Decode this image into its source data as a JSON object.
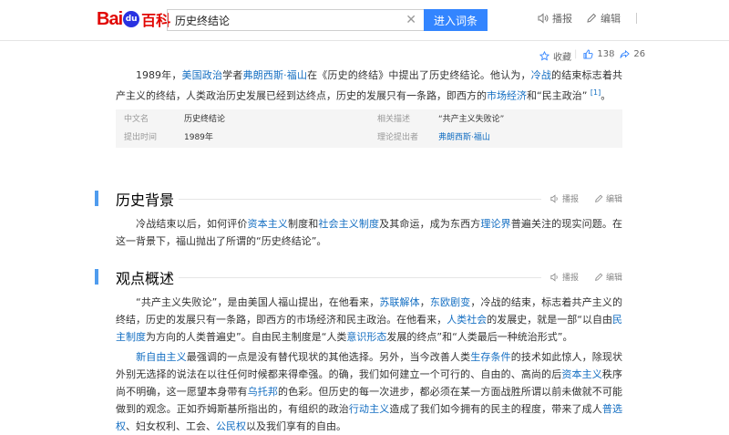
{
  "header": {
    "logo_bai": "Bai",
    "logo_paw": "du",
    "logo_baike": "百科",
    "search_value": "历史终结论",
    "enter_button": "进入词条",
    "play_label": "播报",
    "edit_label": "编辑"
  },
  "sub_toolbar": {
    "collect_label": "收藏",
    "like_count": "138",
    "share_count": "26"
  },
  "intro": {
    "s1": "1989年，",
    "l1": "美国政治",
    "s2": "学者",
    "l2": "弗朗西斯·福山",
    "s3": "在《历史的终结》中提出了历史终结论。他认为，",
    "l3": "冷战",
    "s4": "的结束标志着共产主义的终结，人类政治历史发展已经到达终点，历史的发展只有一条路，即西方的",
    "l4": "市场经济",
    "s5": "和“民主政治”",
    "ref": "[1]",
    "s6": "。"
  },
  "info": {
    "k1": "中文名",
    "v1": "历史终结论",
    "k2": "提出时间",
    "v2": "1989年",
    "k3": "相关描述",
    "v3": "“共产主义失败论”",
    "k4": "理论提出者",
    "v4": "弗朗西斯·福山"
  },
  "section1": {
    "title": "历史背景",
    "play_label": "播报",
    "edit_label": "编辑",
    "s1": "冷战结束以后，如何评价",
    "l1": "资本主义",
    "s2": "制度和",
    "l2": "社会主义制度",
    "s3": "及其命运，成为东西方",
    "l3": "理论界",
    "s4": "普遍关注的现实问题。在这一背景下，福山抛出了所谓的“历史终结论”。"
  },
  "section2": {
    "title": "观点概述",
    "play_label": "播报",
    "edit_label": "编辑",
    "p1": {
      "s1": "“共产主义失败论”，是由美国人福山提出，在他看来，",
      "l1": "苏联解体",
      "s2": "，",
      "l2": "东欧剧变",
      "s3": "，冷战的结束，标志着共产主义的终结，历史的发展只有一条路，即西方的市场经济和民主政治。在他看来，",
      "l3": "人类社会",
      "s4": "的发展史，就是一部“以自由",
      "l4": "民主制度",
      "s5": "为方向的人类普遍史”。自由民主制度是“人类",
      "l5": "意识形态",
      "s6": "发展的终点”和“人类最后一种统治形式”。"
    },
    "p2": {
      "l1": "新自由主义",
      "s1": "最强调的一点是没有替代现状的其他选择。另外，当今改善人类",
      "l2": "生存条件",
      "s2": "的技术如此惊人，除现状外别无选择的说法在以往任何时候都来得牵强。的确，我们如何建立一个可行的、自由的、高尚的后",
      "l3": "资本主义",
      "s3": "秩序尚不明确，这一愿望本身带有",
      "l4": "乌托邦",
      "s4": "的色彩。但历史的每一次进步，都必须在某一方面战胜所谓以前未做就不可能做到的观念。正如乔姆斯基所指出的，有组织的政治",
      "l5": "行动主义",
      "s5": "造成了我们如今拥有的民主的程度，带来了成人",
      "l6": "普选权",
      "s6": "、妇女权利、工会、",
      "l7": "公民权",
      "s7": "以及我们享有的自由。"
    }
  }
}
